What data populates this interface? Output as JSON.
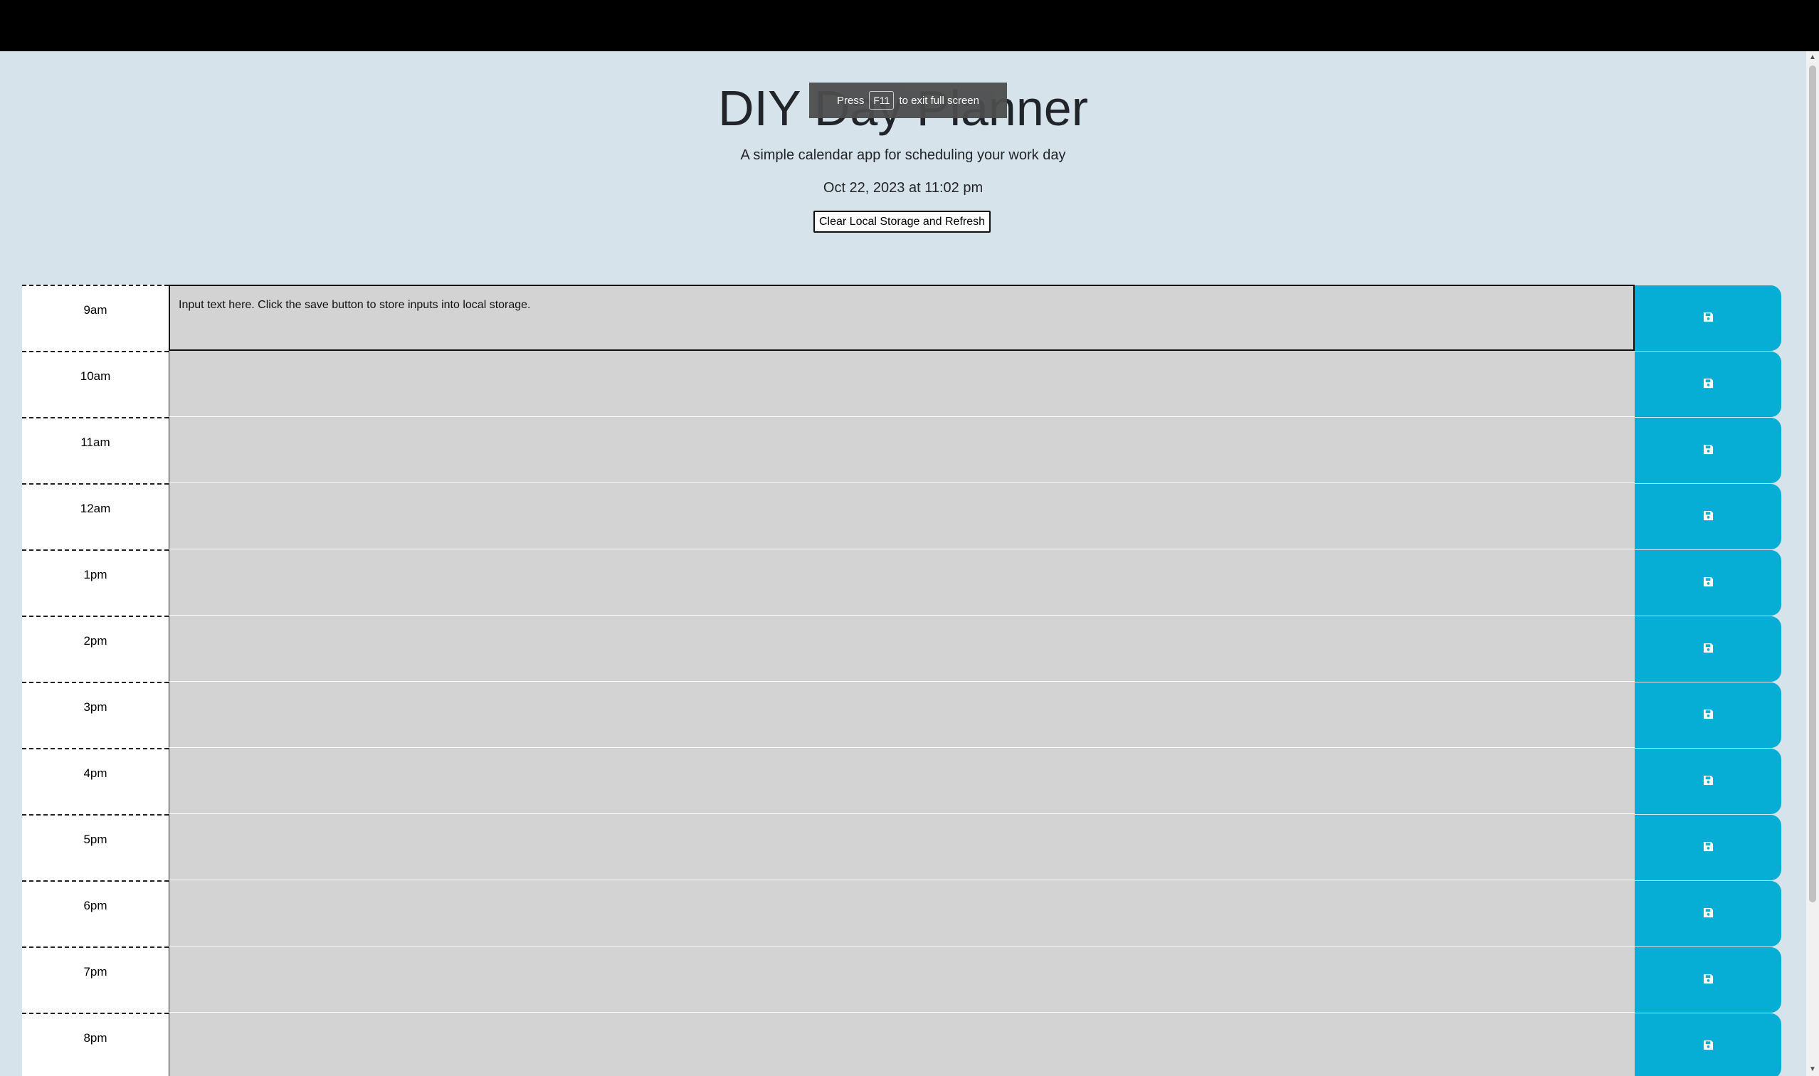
{
  "header": {
    "title": "DIY Day Planner",
    "subtitle": "A simple calendar app for scheduling your work day",
    "current_date": "Oct 22, 2023 at 11:02 pm",
    "clear_button_label": "Clear Local Storage and Refresh"
  },
  "fullscreen_toast": {
    "before": "Press",
    "key": "F11",
    "after": "to exit full screen"
  },
  "planner": {
    "placeholder": "Input text here. Click the save button to store inputs into local storage.",
    "save_icon": "floppy-disk-icon",
    "rows": [
      {
        "hour": "9am",
        "text": ""
      },
      {
        "hour": "10am",
        "text": ""
      },
      {
        "hour": "11am",
        "text": ""
      },
      {
        "hour": "12am",
        "text": ""
      },
      {
        "hour": "1pm",
        "text": ""
      },
      {
        "hour": "2pm",
        "text": ""
      },
      {
        "hour": "3pm",
        "text": ""
      },
      {
        "hour": "4pm",
        "text": ""
      },
      {
        "hour": "5pm",
        "text": ""
      },
      {
        "hour": "6pm",
        "text": ""
      },
      {
        "hour": "7pm",
        "text": ""
      },
      {
        "hour": "8pm",
        "text": ""
      }
    ]
  },
  "colors": {
    "page_background": "#d6e3eb",
    "text_area": "#d3d3d3",
    "save_button": "#06aed5",
    "hour_column": "#ffffff"
  }
}
